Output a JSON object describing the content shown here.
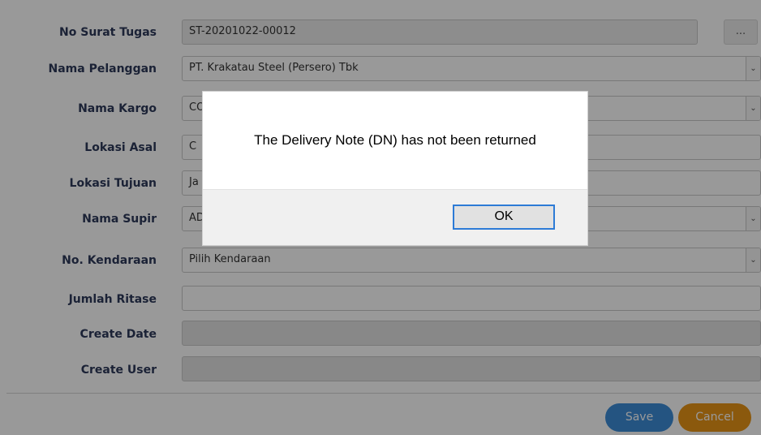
{
  "form": {
    "no_surat_tugas": {
      "label": "No Surat Tugas",
      "value": "ST-20201022-00012",
      "lookup_label": "..."
    },
    "nama_pelanggan": {
      "label": "Nama Pelanggan",
      "value": "PT. Krakatau Steel (Persero) Tbk"
    },
    "nama_kargo": {
      "label": "Nama Kargo",
      "value": "CO"
    },
    "lokasi_asal": {
      "label": "Lokasi Asal",
      "value": "C"
    },
    "lokasi_tujuan": {
      "label": "Lokasi Tujuan",
      "value": "Ja"
    },
    "nama_supir": {
      "label": "Nama Supir",
      "value": "AD"
    },
    "no_kendaraan": {
      "label": "No. Kendaraan",
      "value": "Pilih Kendaraan"
    },
    "jumlah_ritase": {
      "label": "Jumlah Ritase",
      "value": ""
    },
    "create_date": {
      "label": "Create Date",
      "value": ""
    },
    "create_user": {
      "label": "Create User",
      "value": ""
    }
  },
  "footer": {
    "save_label": "Save",
    "cancel_label": "Cancel"
  },
  "dialog": {
    "message": "The Delivery Note (DN) has not been returned",
    "ok_label": "OK"
  },
  "icons": {
    "dropdown": "chevron-down-icon"
  },
  "colors": {
    "save": "#3c8dd8",
    "cancel": "#e89417",
    "label": "#2d3a5a",
    "ok_border": "#2d7bd6"
  }
}
